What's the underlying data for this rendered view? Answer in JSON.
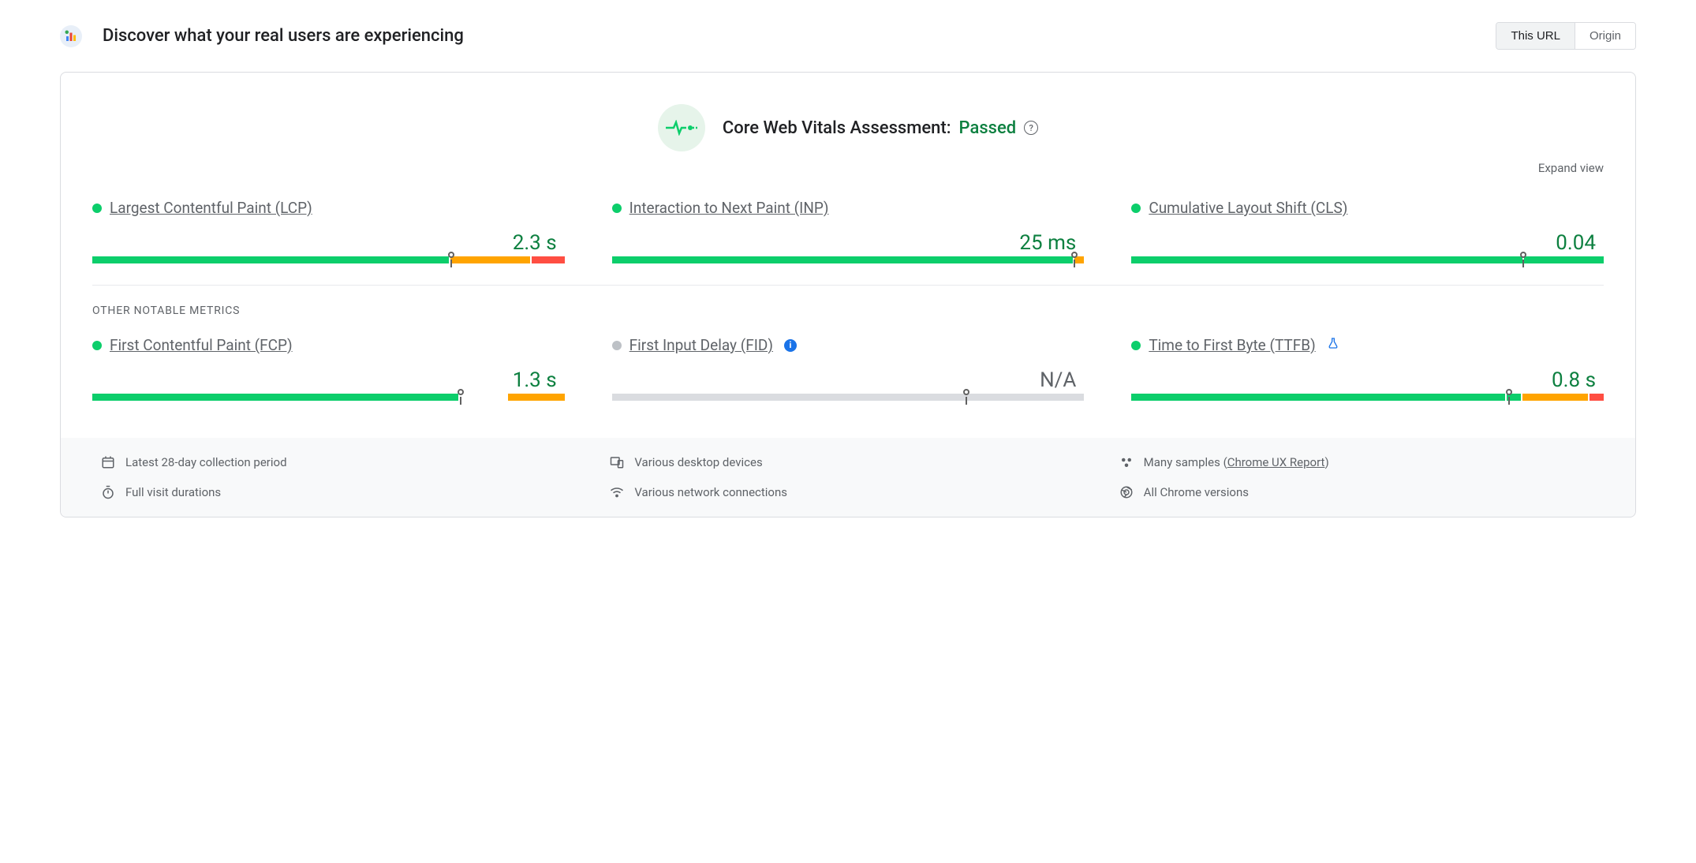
{
  "header": {
    "title": "Discover what your real users are experiencing",
    "toggle": {
      "this_url": "This URL",
      "origin": "Origin"
    }
  },
  "assessment": {
    "label": "Core Web Vitals Assessment:",
    "status": "Passed"
  },
  "expand_label": "Expand view",
  "section_other": "OTHER NOTABLE METRICS",
  "colors": {
    "good": "#0cce6b",
    "needs": "#ffa400",
    "poor": "#ff4e42",
    "grey": "#dadce0",
    "pass_text": "#0d8040"
  },
  "metrics": {
    "lcp": {
      "name": "Largest Contentful Paint (LCP)",
      "value": "2.3 s",
      "status": "good",
      "dist": {
        "good": 76,
        "needs": 17,
        "poor": 7
      },
      "marker_pct": 76
    },
    "inp": {
      "name": "Interaction to Next Paint (INP)",
      "value": "25 ms",
      "status": "good",
      "dist": {
        "good": 98,
        "needs": 2,
        "poor": 0
      },
      "marker_pct": 98
    },
    "cls": {
      "name": "Cumulative Layout Shift (CLS)",
      "value": "0.04",
      "status": "good",
      "dist": {
        "good": 83,
        "needs": 0,
        "poor": 0
      },
      "marker_pct": 83,
      "tail_good": 17
    },
    "fcp": {
      "name": "First Contentful Paint (FCP)",
      "value": "1.3 s",
      "status": "good",
      "dist": {
        "good": 78,
        "needs": 12,
        "poor": 0
      },
      "marker_pct": 78,
      "gap_after_good": 10
    },
    "fid": {
      "name": "First Input Delay (FID)",
      "value": "N/A",
      "status": "na",
      "dist": {
        "good": 0,
        "needs": 0,
        "poor": 0
      },
      "marker_pct": 75,
      "grey": true
    },
    "ttfb": {
      "name": "Time to First Byte (TTFB)",
      "value": "0.8 s",
      "status": "good",
      "dist": {
        "good": 80,
        "needs": 17,
        "poor": 3
      },
      "marker_pct": 80,
      "tiny_good_after_marker": 3,
      "experimental": true
    }
  },
  "footer": {
    "period": "Latest 28-day collection period",
    "devices": "Various desktop devices",
    "samples": "Many samples",
    "samples_link": "Chrome UX Report",
    "duration": "Full visit durations",
    "network": "Various network connections",
    "chrome": "All Chrome versions"
  }
}
